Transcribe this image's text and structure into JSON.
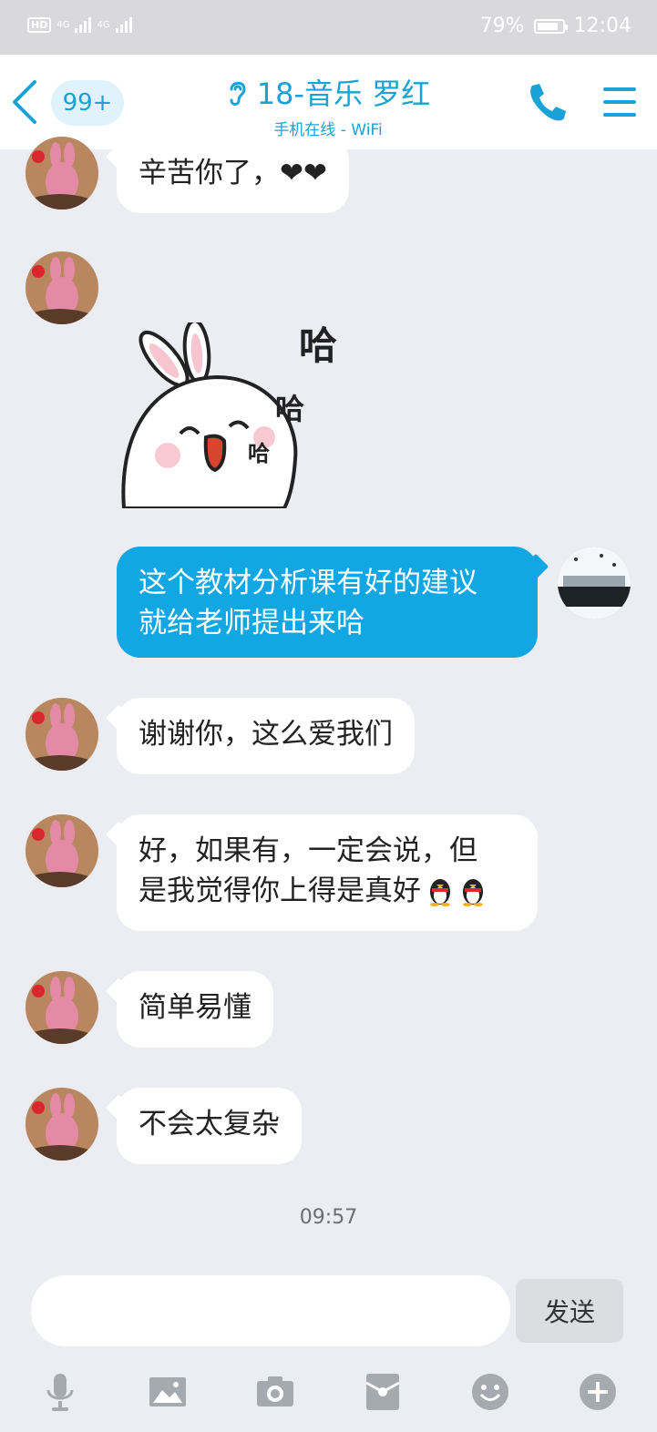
{
  "status_bar": {
    "hd": "HD",
    "network1": "4G",
    "network2": "4G",
    "battery": "79%",
    "time": "12:04"
  },
  "header": {
    "unread_count": "99+",
    "title": "18-音乐  罗红",
    "subtitle": "手机在线 - WiFi"
  },
  "messages": [
    {
      "side": "left",
      "text": "辛苦你了，❤❤"
    },
    {
      "side": "left",
      "type": "sticker",
      "sticker_text": [
        "哈",
        "哈",
        "哈"
      ]
    },
    {
      "side": "right",
      "text_lines": [
        "这个教材分析课有好的建议",
        "就给老师提出来哈"
      ]
    },
    {
      "side": "left",
      "text": "谢谢你，这么爱我们"
    },
    {
      "side": "left",
      "text_lines": [
        "好，如果有，一定会说，但",
        "是我觉得你上得是真好"
      ]
    },
    {
      "side": "left",
      "text": "简单易懂"
    },
    {
      "side": "left",
      "text": "不会太复杂"
    }
  ],
  "timestamp": "09:57",
  "composer": {
    "input_value": "",
    "send_label": "发送"
  },
  "toolbar_icons": [
    "microphone-icon",
    "image-icon",
    "camera-icon",
    "red-packet-icon",
    "emoji-icon",
    "plus-icon"
  ],
  "colors": {
    "accent": "#12a6e2",
    "background": "#ebedf2"
  }
}
